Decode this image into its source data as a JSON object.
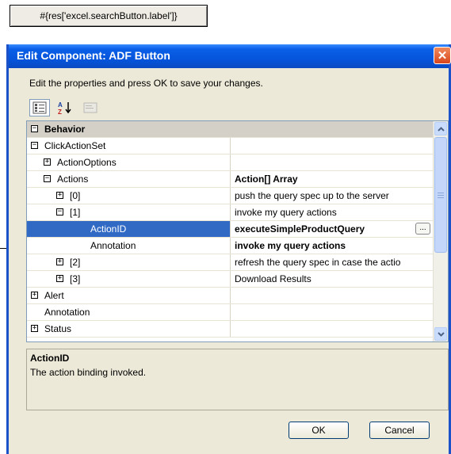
{
  "top_button": {
    "label": "#{res['excel.searchButton.label']}"
  },
  "dialog": {
    "title": "Edit Component: ADF Button",
    "close_glyph": "✕",
    "instructions": "Edit the properties and press OK to save your changes.",
    "toolbar": {
      "categorized_icon": "categorized-view-icon",
      "alphabetical_icon": "alphabetical-sort-icon",
      "property_pages_icon": "property-pages-icon"
    },
    "rows": [
      {
        "name": "Behavior",
        "value": "",
        "category": true,
        "expander": "−"
      },
      {
        "name": "ClickActionSet",
        "value": "",
        "expander": "−"
      },
      {
        "name": "ActionOptions",
        "value": "",
        "expander": "+"
      },
      {
        "name": "Actions",
        "value": "Action[] Array",
        "expander": "−",
        "value_bold": true
      },
      {
        "name": "[0]",
        "value": "push the query spec up to the server",
        "expander": "+"
      },
      {
        "name": "[1]",
        "value": "invoke my query actions",
        "expander": "−"
      },
      {
        "name": "ActionID",
        "value": "executeSimpleProductQuery",
        "selected": true,
        "value_bold": true,
        "ellipsis": "..."
      },
      {
        "name": "Annotation",
        "value": "invoke my query actions",
        "value_bold": true
      },
      {
        "name": "[2]",
        "value": "refresh the query spec in case the actio",
        "expander": "+"
      },
      {
        "name": "[3]",
        "value": "Download Results",
        "expander": "+"
      },
      {
        "name": "Alert",
        "value": "",
        "expander": "+"
      },
      {
        "name": "Annotation",
        "value": ""
      },
      {
        "name": "Status",
        "value": "",
        "expander": "+"
      }
    ],
    "description": {
      "title": "ActionID",
      "text": "The action binding invoked."
    },
    "buttons": {
      "ok": "OK",
      "cancel": "Cancel"
    }
  }
}
